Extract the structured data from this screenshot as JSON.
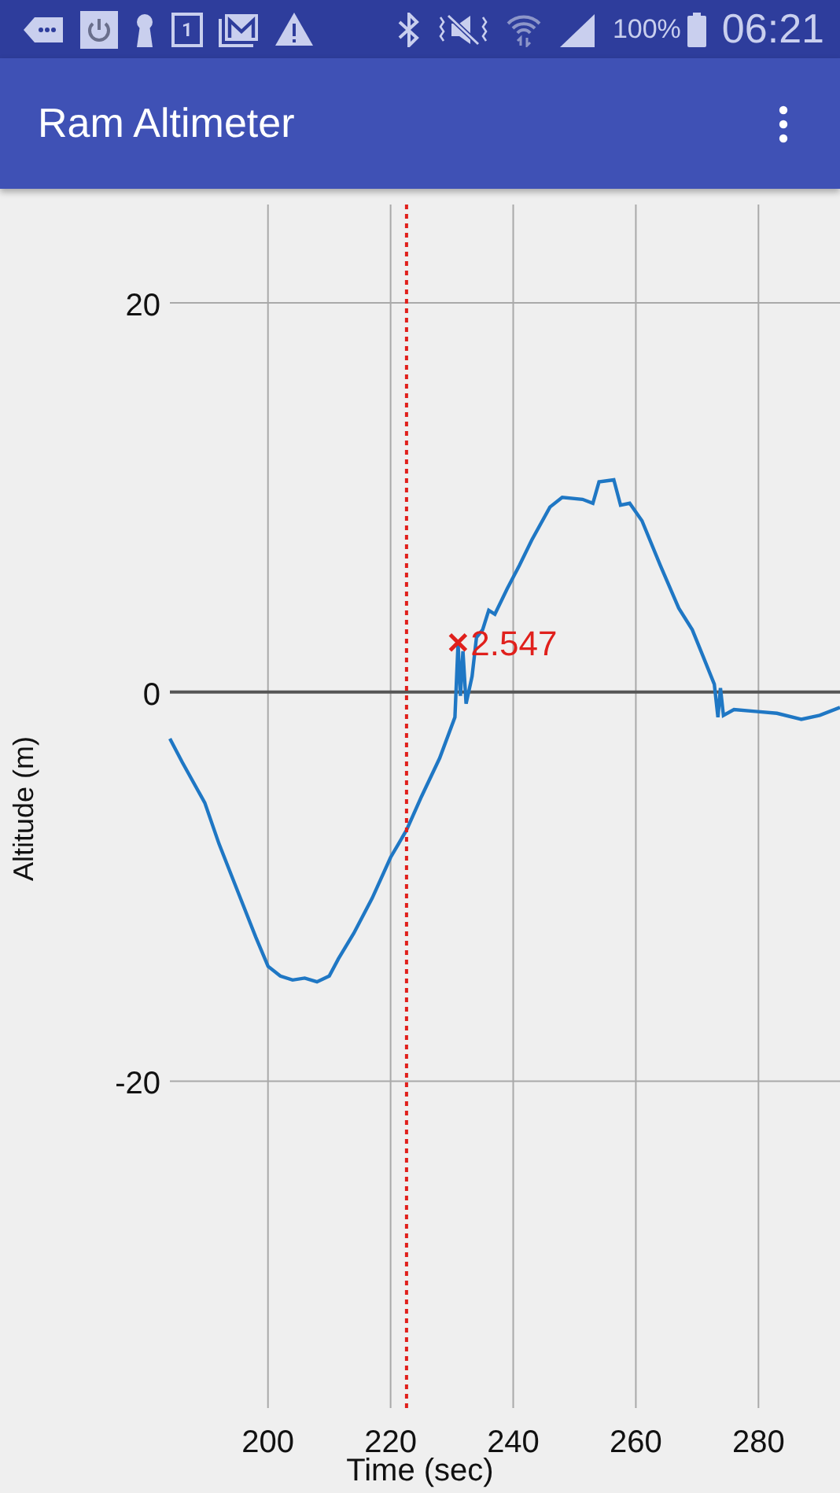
{
  "status_bar": {
    "calendar_day": "1",
    "battery": "100%",
    "time": "06:21"
  },
  "app_bar": {
    "title": "Ram Altimeter"
  },
  "chart": {
    "chart_data": {
      "type": "line",
      "xlabel": "Time (sec)",
      "ylabel": "Altitude (m)",
      "xlim": [
        184,
        293.3
      ],
      "grid": true,
      "ylim": [
        -36.8,
        25.05
      ],
      "xticks": [
        200,
        220,
        240,
        260,
        280
      ],
      "yticks": [
        -20,
        0,
        20
      ],
      "x": [
        184,
        186,
        189.7,
        192,
        195,
        198,
        200,
        202,
        204,
        206,
        208,
        210,
        211.5,
        214,
        217,
        220,
        222.6,
        225,
        228,
        230.5,
        231,
        231.4,
        231.8,
        232.3,
        233.3,
        234,
        235,
        236,
        237,
        239,
        241,
        243,
        246,
        248,
        251.3,
        253,
        254,
        256.4,
        257.5,
        259,
        261,
        264,
        267,
        269.2,
        271,
        272.8,
        273.4,
        273.8,
        274.3,
        276,
        279.5,
        283,
        287,
        290,
        293.3
      ],
      "series": [
        {
          "color": "#1f77c4",
          "values": [
            -2.4,
            -3.6,
            -5.7,
            -7.8,
            -10.2,
            -12.6,
            -14.1,
            -14.6,
            -14.8,
            -14.7,
            -14.9,
            -14.6,
            -13.7,
            -12.4,
            -10.6,
            -8.5,
            -7.1,
            -5.4,
            -3.4,
            -1.3,
            2.5,
            -0.2,
            2.1,
            -0.6,
            0.8,
            2.8,
            3.2,
            4.2,
            4,
            5.3,
            6.5,
            7.8,
            9.5,
            10,
            9.9,
            9.7,
            10.8,
            10.9,
            9.6,
            9.7,
            8.8,
            6.5,
            4.3,
            3.2,
            1.8,
            0.4,
            -1.3,
            0.2,
            -1.2,
            -0.9,
            -1,
            -1.1,
            -1.4,
            -1.2,
            -0.8
          ]
        }
      ],
      "ref_lines": [
        {
          "axis": "x",
          "value": 222.6,
          "color": "#e0201c"
        }
      ],
      "annotations": [
        {
          "x": 231,
          "y": 2.547,
          "text": "2.547"
        }
      ]
    }
  }
}
